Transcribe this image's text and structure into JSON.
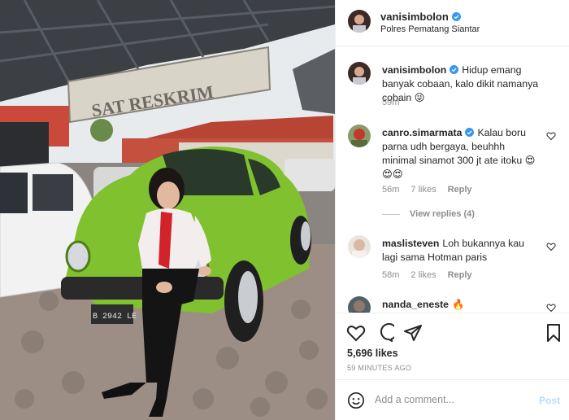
{
  "post": {
    "username": "vanisimbolon",
    "location": "Polres Pematang Siantar",
    "photo_sign_text": "SAT RESKRIM",
    "photo_plate_text": "B 2942 LE"
  },
  "comments": [
    {
      "username": "vanisimbolon",
      "text": "Hidup emang banyak cobaan, kalo dikit namanya cobain 😜",
      "time": "59m"
    },
    {
      "username": "canro.simarmata",
      "text": "Kalau boru parna udh bergaya, beuhhh minimal sinamot 300 jt ate itoku 😍😍😍",
      "time": "56m",
      "likes": "7 likes",
      "reply": "Reply",
      "view_replies": "View replies (4)"
    },
    {
      "username": "maslisteven",
      "text": "Loh bukannya kau lagi sama Hotman paris",
      "time": "58m",
      "likes": "2 likes",
      "reply": "Reply"
    },
    {
      "username": "nanda_eneste",
      "text": "🔥"
    }
  ],
  "actions": {
    "likes": "5,696 likes",
    "time_ago": "59 MINUTES AGO"
  },
  "add_comment": {
    "placeholder": "Add a comment...",
    "post_label": "Post"
  },
  "colors": {
    "verified": "#3897f0",
    "post_disabled": "#b2dffc",
    "muted": "#8e8e8e"
  }
}
